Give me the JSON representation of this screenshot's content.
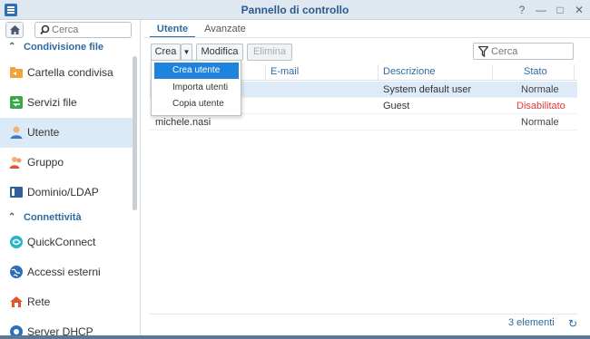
{
  "window": {
    "title": "Pannello di controllo",
    "controls": [
      "help-icon",
      "pin-icon",
      "minimize-icon",
      "maximize-icon",
      "close-icon"
    ]
  },
  "sidebar": {
    "search_placeholder": "Cerca",
    "sections": [
      {
        "label": "Condivisione file"
      },
      {
        "label": "Connettività"
      }
    ],
    "items": [
      {
        "label": "Cartella condivisa",
        "icon": "folder-share-icon"
      },
      {
        "label": "Servizi file",
        "icon": "file-services-icon"
      },
      {
        "label": "Utente",
        "icon": "user-icon"
      },
      {
        "label": "Gruppo",
        "icon": "group-icon"
      },
      {
        "label": "Dominio/LDAP",
        "icon": "domain-icon"
      },
      {
        "label": "QuickConnect",
        "icon": "quickconnect-icon"
      },
      {
        "label": "Accessi esterni",
        "icon": "globe-icon"
      },
      {
        "label": "Rete",
        "icon": "network-icon"
      },
      {
        "label": "Server DHCP",
        "icon": "dhcp-icon"
      }
    ]
  },
  "tabs": [
    {
      "label": "Utente"
    },
    {
      "label": "Avanzate"
    }
  ],
  "toolbar": {
    "create_label": "Crea",
    "edit_label": "Modifica",
    "delete_label": "Elimina",
    "filter_placeholder": "Cerca"
  },
  "menu": {
    "items": [
      {
        "label": "Crea utente"
      },
      {
        "label": "Importa utenti"
      },
      {
        "label": "Copia utente"
      }
    ]
  },
  "table": {
    "columns": [
      "E-mail",
      "Descrizione",
      "Stato"
    ],
    "rows": [
      {
        "name": "",
        "email": "",
        "description": "System default user",
        "status": "Normale"
      },
      {
        "name": "",
        "email": "",
        "description": "Guest",
        "status": "Disabilitato"
      },
      {
        "name": "michele.nasi",
        "email": "",
        "description": "",
        "status": "Normale"
      }
    ]
  },
  "footer": {
    "count_label": "3 elementi"
  },
  "colors": {
    "accent": "#2d6aa3",
    "selected": "#1f83dd",
    "disabled_status": "#e23b3b"
  }
}
